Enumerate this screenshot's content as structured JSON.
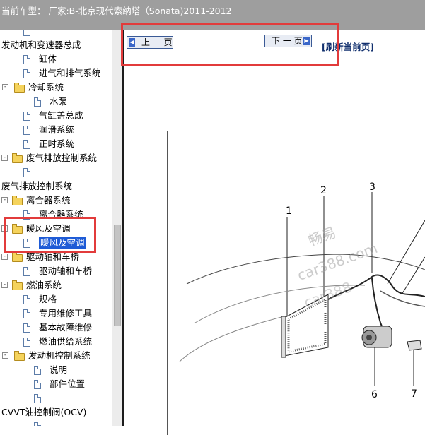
{
  "header": {
    "title": "当前车型：  厂家:B-北京现代索纳塔（Sonata)2011-2012"
  },
  "tree": {
    "items": [
      {
        "label": "",
        "kind": "page"
      },
      {
        "label": "发动机和变速器总成",
        "kind": "text"
      },
      {
        "label": "缸体",
        "kind": "page"
      },
      {
        "label": "进气和排气系统",
        "kind": "page"
      },
      {
        "label": "冷却系统",
        "kind": "folder",
        "expander": "-"
      },
      {
        "label": "水泵",
        "kind": "page"
      },
      {
        "label": "气缸盖总成",
        "kind": "page"
      },
      {
        "label": "润滑系统",
        "kind": "page"
      },
      {
        "label": "正时系统",
        "kind": "page"
      },
      {
        "label": "废气排放控制系统",
        "kind": "folder",
        "expander": "-"
      },
      {
        "label": "",
        "kind": "page"
      },
      {
        "label": "废气排放控制系统",
        "kind": "text"
      },
      {
        "label": "离合器系统",
        "kind": "folder",
        "expander": "-"
      },
      {
        "label": "离合器系统",
        "kind": "page"
      },
      {
        "label": "暖风及空调",
        "kind": "folder",
        "expander": "-"
      },
      {
        "label": "暖风及空调",
        "kind": "page",
        "selected": true
      },
      {
        "label": "驱动轴和车桥",
        "kind": "folder",
        "expander": "-"
      },
      {
        "label": "驱动轴和车桥",
        "kind": "page"
      },
      {
        "label": "燃油系统",
        "kind": "folder",
        "expander": "-"
      },
      {
        "label": "规格",
        "kind": "page"
      },
      {
        "label": "专用维修工具",
        "kind": "page"
      },
      {
        "label": "基本故障维修",
        "kind": "page"
      },
      {
        "label": "燃油供给系统",
        "kind": "page"
      },
      {
        "label": "发动机控制系统",
        "kind": "folder",
        "expander": "-"
      },
      {
        "label": "说明",
        "kind": "page"
      },
      {
        "label": "部件位置",
        "kind": "page"
      },
      {
        "label": "",
        "kind": "page"
      },
      {
        "label": "CVVT油控制阀(OCV)",
        "kind": "text"
      },
      {
        "label": "",
        "kind": "page"
      }
    ]
  },
  "toolbar": {
    "prev_label": "上 一 页",
    "next_label": "下 一 页",
    "refresh_label": "[刷新当前页]"
  },
  "figure": {
    "callouts": [
      "1",
      "2",
      "3",
      "6",
      "7"
    ],
    "watermark_lines": [
      "畅易",
      "car388.com",
      "car388"
    ]
  },
  "colors": {
    "header_bg": "#9e9e9e",
    "highlight_red": "#e23b3b",
    "selected_bg": "#1e5bd6",
    "button_border": "#3a5a96"
  }
}
